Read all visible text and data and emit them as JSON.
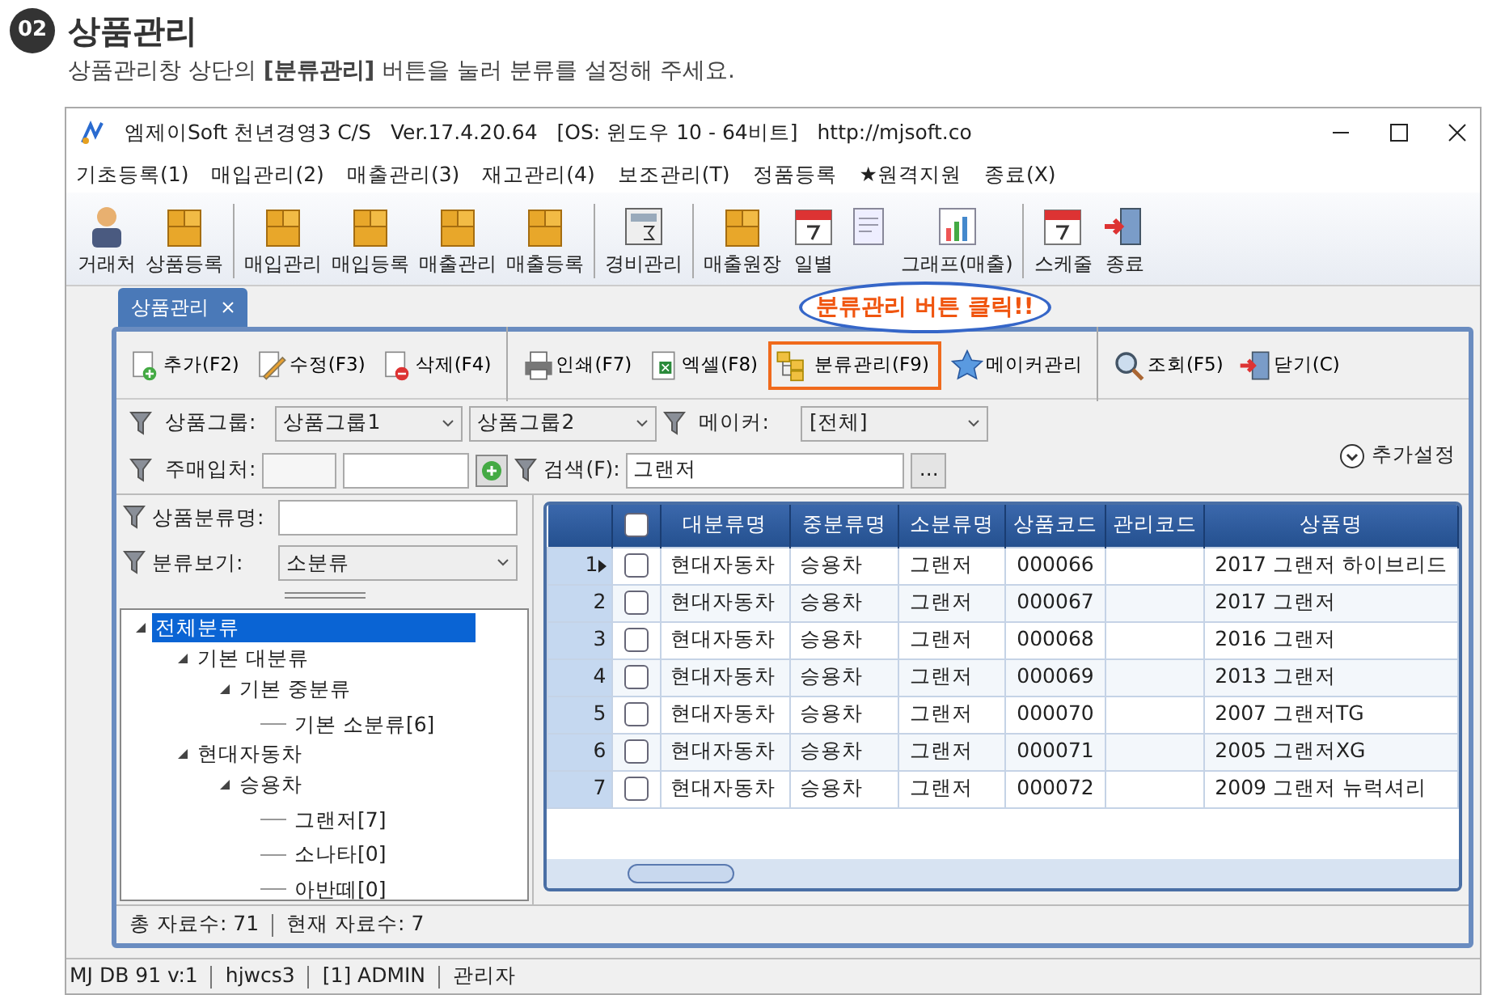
{
  "header": {
    "step": "02",
    "title": "상품관리",
    "instruction": "상품관리창 상단의 **[분류관리]** 버튼을 눌러 분류를 설정해 주세요."
  },
  "window": {
    "title": "엠제이Soft 천년경영3 C/S",
    "version": "Ver.17.4.20.64",
    "os": "[OS: 윈도우 10 - 64비트]",
    "url": "http://mjsoft.co"
  },
  "menu": [
    "기초등록(1)",
    "매입관리(2)",
    "매출관리(3)",
    "재고관리(4)",
    "보조관리(T)",
    "정품등록",
    "★원격지원",
    "종료(X)"
  ],
  "toolbar": [
    {
      "label": "거래처",
      "separator_before": false
    },
    {
      "label": "상품등록",
      "separator_before": false
    },
    {
      "label": "매입관리",
      "separator_before": true
    },
    {
      "label": "매입등록",
      "separator_before": false
    },
    {
      "label": "매출관리",
      "separator_before": false
    },
    {
      "label": "매출등록",
      "separator_before": false
    },
    {
      "label": "경비관리",
      "separator_before": true
    },
    {
      "label": "매출원장",
      "separator_before": true
    },
    {
      "label": "일별",
      "separator_before": false
    },
    {
      "separator_before": false
    },
    {
      "label": "그래프(매출)",
      "separator_before": false
    },
    {
      "label": "스케줄",
      "separator_before": true
    },
    {
      "label": "종료",
      "separator_before": false
    }
  ],
  "callout": "분류관리 버튼 클릭!!",
  "tabs": [
    {
      "label": "상품관리",
      "selected": true
    }
  ],
  "inner_toolbar": [
    {
      "label": "추가(F2)",
      "highlighted": false
    },
    {
      "label": "수정(F3)",
      "highlighted": false
    },
    {
      "label": "삭제(F4)",
      "highlighted": false
    },
    {
      "label": "인쇄(F7)",
      "highlighted": false
    },
    {
      "label": "엑셀(F8)",
      "highlighted": false
    },
    {
      "label": "분류관리(F9)",
      "highlighted": true
    },
    {
      "label": "메이커관리",
      "highlighted": false
    },
    {
      "label": "조회(F5)",
      "highlighted": false
    },
    {
      "label": "닫기(C)",
      "highlighted": false
    }
  ],
  "filters": {
    "group_label": "상품그룹:",
    "group1": "상품그룹1",
    "group2": "상품그룹2",
    "maker_label": "메이커:",
    "maker": "[전체]",
    "more": "추가설정",
    "buyer_label": "주매입처:",
    "search_label": "검색(F):",
    "search": "그랜저",
    "browse": "..."
  },
  "left_panel": {
    "name_label": "상품분류명:",
    "view_label": "분류보기:",
    "view": "소분류",
    "tree": [
      {
        "label": "전체분류",
        "selected": true,
        "expanded": true,
        "children": [
          {
            "label": "기본 대분류",
            "selected": false,
            "expanded": true,
            "children": [
              {
                "label": "기본 중분류",
                "selected": false,
                "expanded": true,
                "children": [
                  {
                    "label": "기본 소분류[6]",
                    "selected": false
                  }
                ]
              }
            ]
          },
          {
            "label": "현대자동차",
            "selected": false,
            "expanded": true,
            "children": [
              {
                "label": "승용차",
                "selected": false,
                "expanded": true,
                "children": [
                  {
                    "label": "그랜저[7]",
                    "selected": false
                  },
                  {
                    "label": "소나타[0]",
                    "selected": false
                  },
                  {
                    "label": "아반떼[0]",
                    "selected": false
                  }
                ]
              }
            ]
          }
        ]
      }
    ]
  },
  "table": {
    "header_checked": false,
    "columns": [
      "대분류명",
      "중분류명",
      "소분류명",
      "상품코드",
      "관리코드",
      "상품명"
    ],
    "rows": [
      {
        "num": "1",
        "selected": true,
        "checked": false,
        "cells": [
          "현대자동차",
          "승용차",
          "그랜저",
          "000066",
          "",
          "2017 그랜저 하이브리드"
        ]
      },
      {
        "num": "2",
        "selected": false,
        "checked": false,
        "cells": [
          "현대자동차",
          "승용차",
          "그랜저",
          "000067",
          "",
          "2017 그랜저"
        ]
      },
      {
        "num": "3",
        "selected": false,
        "checked": false,
        "cells": [
          "현대자동차",
          "승용차",
          "그랜저",
          "000068",
          "",
          "2016 그랜저"
        ]
      },
      {
        "num": "4",
        "selected": false,
        "checked": false,
        "cells": [
          "현대자동차",
          "승용차",
          "그랜저",
          "000069",
          "",
          "2013 그랜저"
        ]
      },
      {
        "num": "5",
        "selected": false,
        "checked": false,
        "cells": [
          "현대자동차",
          "승용차",
          "그랜저",
          "000070",
          "",
          "2007 그랜저TG"
        ]
      },
      {
        "num": "6",
        "selected": false,
        "checked": false,
        "cells": [
          "현대자동차",
          "승용차",
          "그랜저",
          "000071",
          "",
          "2005 그랜저XG"
        ]
      },
      {
        "num": "7",
        "selected": false,
        "checked": false,
        "cells": [
          "현대자동차",
          "승용차",
          "그랜저",
          "000072",
          "",
          "2009 그랜저 뉴럭셔리"
        ]
      }
    ]
  },
  "inner_status": [
    "총 자료수: 71",
    "현재 자료수: 7"
  ],
  "status_bar": [
    "MJ DB 91 v:1",
    "hjwcs3",
    "[1] ADMIN",
    "관리자"
  ]
}
